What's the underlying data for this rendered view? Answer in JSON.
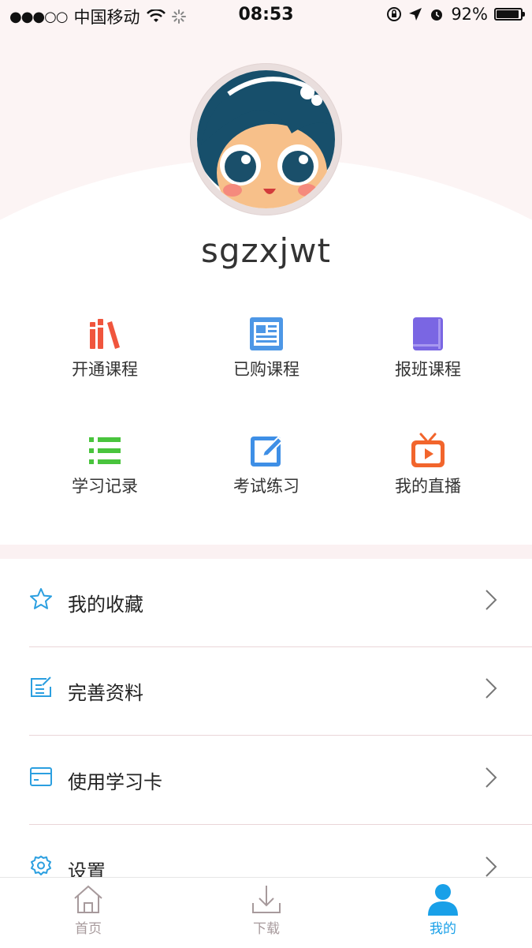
{
  "status_bar": {
    "carrier": "中国移动",
    "time": "08:53",
    "battery_percent": "92%",
    "battery_level": 0.92
  },
  "profile": {
    "username": "sgzxjwt"
  },
  "grid": [
    {
      "label": "开通课程",
      "icon": "bookshelf-icon",
      "color": "#f0553d"
    },
    {
      "label": "已购课程",
      "icon": "document-icon",
      "color": "#4d97e6"
    },
    {
      "label": "报班课程",
      "icon": "book-icon",
      "color": "#7a66e3"
    },
    {
      "label": "学习记录",
      "icon": "list-icon",
      "color": "#49c43d"
    },
    {
      "label": "考试练习",
      "icon": "edit-icon",
      "color": "#3e8fe6"
    },
    {
      "label": "我的直播",
      "icon": "tv-icon",
      "color": "#f2652c"
    }
  ],
  "menu": [
    {
      "label": "我的收藏",
      "icon": "star-icon"
    },
    {
      "label": "完善资料",
      "icon": "profile-edit-icon"
    },
    {
      "label": "使用学习卡",
      "icon": "card-icon"
    },
    {
      "label": "设置",
      "icon": "gear-icon"
    }
  ],
  "tabs": [
    {
      "label": "首页",
      "icon": "home-icon",
      "active": false
    },
    {
      "label": "下载",
      "icon": "download-icon",
      "active": false
    },
    {
      "label": "我的",
      "icon": "user-icon",
      "active": true
    }
  ],
  "colors": {
    "accent": "#19a0e8",
    "menu_icon": "#2b9fe0",
    "header_bg": "#fcf4f4"
  }
}
